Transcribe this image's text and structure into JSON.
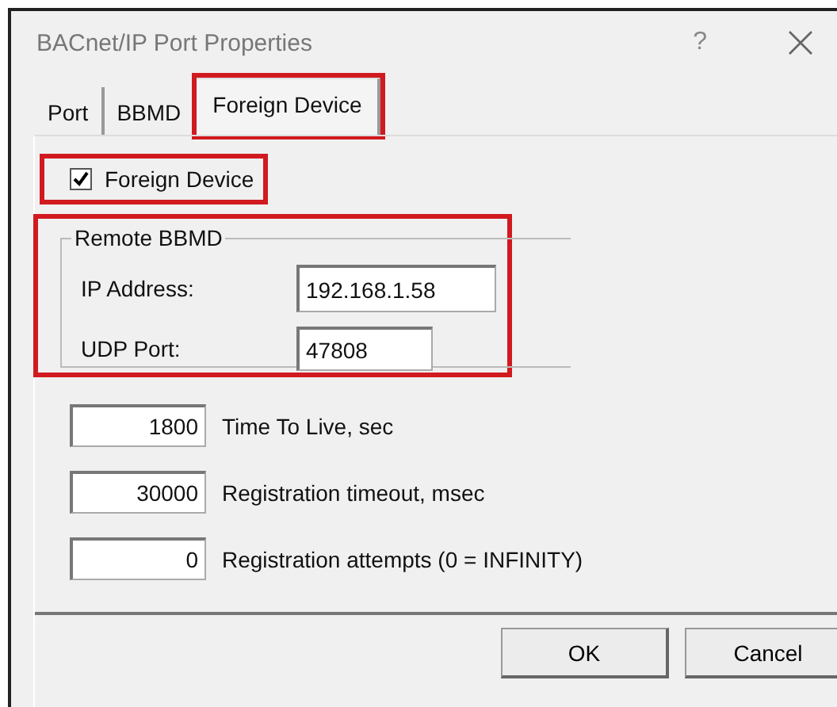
{
  "window": {
    "title": "BACnet/IP Port Properties",
    "help": "?"
  },
  "tabs": [
    {
      "label": "Port",
      "selected": false,
      "highlighted": false
    },
    {
      "label": "BBMD",
      "selected": false,
      "highlighted": false
    },
    {
      "label": "Foreign Device",
      "selected": true,
      "highlighted": true
    }
  ],
  "foreign_device": {
    "label": "Foreign Device",
    "checked": true,
    "highlighted": true
  },
  "remote_bbmd": {
    "title": "Remote BBMD",
    "highlighted": true,
    "fields": [
      {
        "label": "IP Address:",
        "value": "192.168.1.58",
        "kind": "wide"
      },
      {
        "label": "UDP Port:",
        "value": "47808",
        "kind": "narrow"
      }
    ]
  },
  "settings": [
    {
      "value": "1800",
      "label": "Time To Live, sec"
    },
    {
      "value": "30000",
      "label": "Registration timeout, msec"
    },
    {
      "value": "0",
      "label": "Registration attempts (0 = INFINITY)"
    }
  ],
  "buttons": [
    "OK",
    "Cancel"
  ]
}
